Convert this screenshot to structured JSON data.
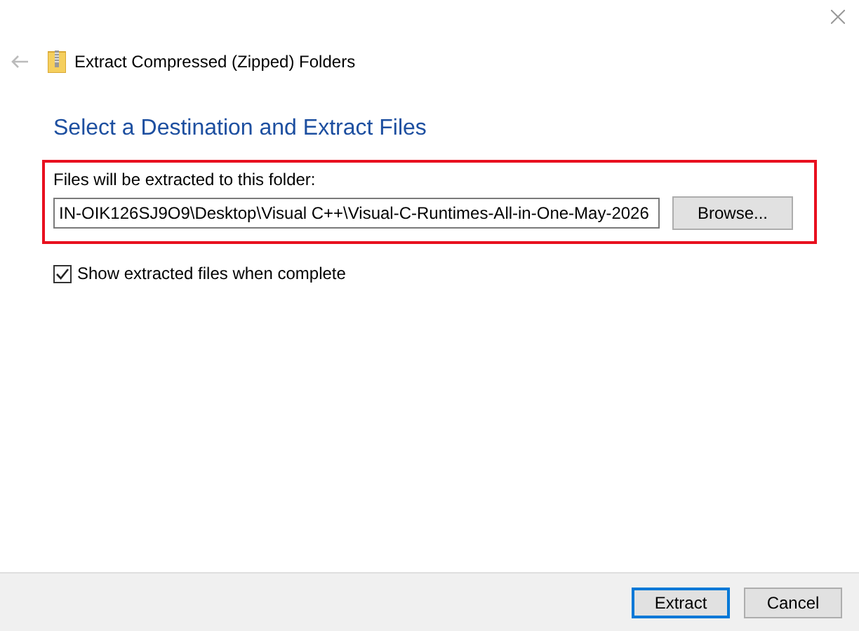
{
  "window": {
    "title": "Extract Compressed (Zipped) Folders"
  },
  "heading": "Select a Destination and Extract Files",
  "destination": {
    "label": "Files will be extracted to this folder:",
    "value": "IN-OIK126SJ9O9\\Desktop\\Visual C++\\Visual-C-Runtimes-All-in-One-May-2026",
    "browse": "Browse..."
  },
  "show_files": {
    "label": "Show extracted files when complete",
    "checked": true
  },
  "buttons": [
    {
      "label": "Extract",
      "default": true
    },
    {
      "label": "Cancel",
      "default": false
    }
  ]
}
